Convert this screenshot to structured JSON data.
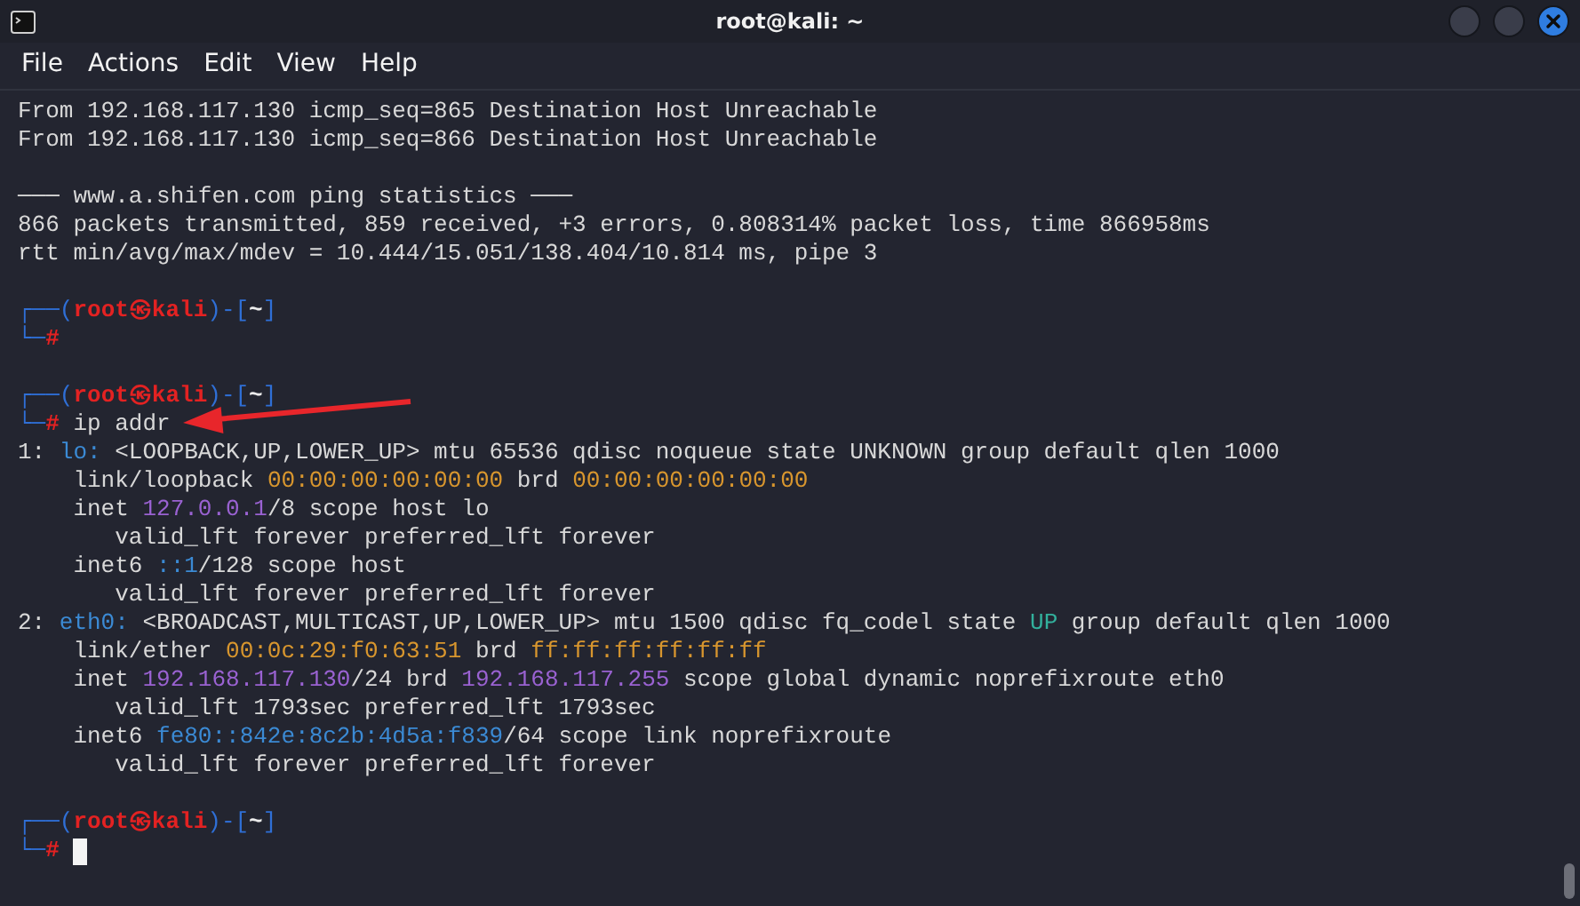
{
  "window": {
    "title": "root@kali: ~"
  },
  "menu": [
    "File",
    "Actions",
    "Edit",
    "View",
    "Help"
  ],
  "lines": [
    {
      "kind": "text",
      "segments": [
        {
          "text": "From 192.168.117.130 icmp_seq=865 Destination Host Unreachable",
          "color": "#d8d8d8"
        }
      ]
    },
    {
      "kind": "text",
      "segments": [
        {
          "text": "From 192.168.117.130 icmp_seq=866 Destination Host Unreachable",
          "color": "#d8d8d8"
        }
      ]
    },
    {
      "kind": "blank"
    },
    {
      "kind": "text",
      "segments": [
        {
          "text": "─── www.a.shifen.com ping statistics ───",
          "color": "#d8d8d8"
        }
      ]
    },
    {
      "kind": "text",
      "segments": [
        {
          "text": "866 packets transmitted, 859 received, +3 errors, 0.808314% packet loss, time 866958ms",
          "color": "#d8d8d8"
        }
      ]
    },
    {
      "kind": "text",
      "segments": [
        {
          "text": "rtt min/avg/max/mdev = 10.444/15.051/138.404/10.814 ms, pipe 3",
          "color": "#d8d8d8"
        }
      ]
    },
    {
      "kind": "blank"
    },
    {
      "kind": "text",
      "segments": [
        {
          "text": "┌──(",
          "color": "#2f6fd6"
        },
        {
          "text": "root㉿kali",
          "color": "#e32222",
          "bold": true
        },
        {
          "text": ")-[",
          "color": "#2f6fd6"
        },
        {
          "text": "~",
          "color": "#ececec",
          "bold": true
        },
        {
          "text": "]",
          "color": "#2f6fd6"
        }
      ]
    },
    {
      "kind": "text",
      "segments": [
        {
          "text": "└─",
          "color": "#2f6fd6"
        },
        {
          "text": "#",
          "color": "#e32222",
          "bold": true
        }
      ]
    },
    {
      "kind": "blank"
    },
    {
      "kind": "text",
      "segments": [
        {
          "text": "┌──(",
          "color": "#2f6fd6"
        },
        {
          "text": "root㉿kali",
          "color": "#e32222",
          "bold": true
        },
        {
          "text": ")-[",
          "color": "#2f6fd6"
        },
        {
          "text": "~",
          "color": "#ececec",
          "bold": true
        },
        {
          "text": "]",
          "color": "#2f6fd6"
        }
      ]
    },
    {
      "kind": "text",
      "segments": [
        {
          "text": "└─",
          "color": "#2f6fd6"
        },
        {
          "text": "#",
          "color": "#e32222",
          "bold": true
        },
        {
          "text": " ip addr",
          "color": "#d8d8d8"
        }
      ]
    },
    {
      "kind": "text",
      "segments": [
        {
          "text": "1: ",
          "color": "#d8d8d8"
        },
        {
          "text": "lo:",
          "color": "#3b8ad4"
        },
        {
          "text": " <LOOPBACK,UP,LOWER_UP> mtu 65536 qdisc noqueue state UNKNOWN group default qlen 1000",
          "color": "#d8d8d8"
        }
      ]
    },
    {
      "kind": "text",
      "segments": [
        {
          "text": "    link/loopback ",
          "color": "#d8d8d8"
        },
        {
          "text": "00:00:00:00:00:00",
          "color": "#d8962e"
        },
        {
          "text": " brd ",
          "color": "#d8d8d8"
        },
        {
          "text": "00:00:00:00:00:00",
          "color": "#d8962e"
        }
      ]
    },
    {
      "kind": "text",
      "segments": [
        {
          "text": "    inet ",
          "color": "#d8d8d8"
        },
        {
          "text": "127.0.0.1",
          "color": "#9a62d2"
        },
        {
          "text": "/8 scope host lo",
          "color": "#d8d8d8"
        }
      ]
    },
    {
      "kind": "text",
      "segments": [
        {
          "text": "       valid_lft forever preferred_lft forever",
          "color": "#d8d8d8"
        }
      ]
    },
    {
      "kind": "text",
      "segments": [
        {
          "text": "    inet6 ",
          "color": "#d8d8d8"
        },
        {
          "text": "::1",
          "color": "#3b8ad4"
        },
        {
          "text": "/128 scope host",
          "color": "#d8d8d8"
        }
      ]
    },
    {
      "kind": "text",
      "segments": [
        {
          "text": "       valid_lft forever preferred_lft forever",
          "color": "#d8d8d8"
        }
      ]
    },
    {
      "kind": "text",
      "segments": [
        {
          "text": "2: ",
          "color": "#d8d8d8"
        },
        {
          "text": "eth0:",
          "color": "#3b8ad4"
        },
        {
          "text": " <BROADCAST,MULTICAST,UP,LOWER_UP> mtu 1500 qdisc fq_codel state ",
          "color": "#d8d8d8"
        },
        {
          "text": "UP",
          "color": "#32b09c"
        },
        {
          "text": " group default qlen 1000",
          "color": "#d8d8d8"
        }
      ]
    },
    {
      "kind": "text",
      "segments": [
        {
          "text": "    link/ether ",
          "color": "#d8d8d8"
        },
        {
          "text": "00:0c:29:f0:63:51",
          "color": "#d8962e"
        },
        {
          "text": " brd ",
          "color": "#d8d8d8"
        },
        {
          "text": "ff:ff:ff:ff:ff:ff",
          "color": "#d8962e"
        }
      ]
    },
    {
      "kind": "text",
      "segments": [
        {
          "text": "    inet ",
          "color": "#d8d8d8"
        },
        {
          "text": "192.168.117.130",
          "color": "#9a62d2"
        },
        {
          "text": "/24 brd ",
          "color": "#d8d8d8"
        },
        {
          "text": "192.168.117.255",
          "color": "#9a62d2"
        },
        {
          "text": " scope global dynamic noprefixroute eth0",
          "color": "#d8d8d8"
        }
      ]
    },
    {
      "kind": "text",
      "segments": [
        {
          "text": "       valid_lft 1793sec preferred_lft 1793sec",
          "color": "#d8d8d8"
        }
      ]
    },
    {
      "kind": "text",
      "segments": [
        {
          "text": "    inet6 ",
          "color": "#d8d8d8"
        },
        {
          "text": "fe80::842e:8c2b:4d5a:f839",
          "color": "#3b8ad4"
        },
        {
          "text": "/64 scope link noprefixroute",
          "color": "#d8d8d8"
        }
      ]
    },
    {
      "kind": "text",
      "segments": [
        {
          "text": "       valid_lft forever preferred_lft forever",
          "color": "#d8d8d8"
        }
      ]
    },
    {
      "kind": "blank"
    },
    {
      "kind": "text",
      "segments": [
        {
          "text": "┌──(",
          "color": "#2f6fd6"
        },
        {
          "text": "root㉿kali",
          "color": "#e32222",
          "bold": true
        },
        {
          "text": ")-[",
          "color": "#2f6fd6"
        },
        {
          "text": "~",
          "color": "#ececec",
          "bold": true
        },
        {
          "text": "]",
          "color": "#2f6fd6"
        }
      ]
    },
    {
      "kind": "text",
      "cursor": true,
      "segments": [
        {
          "text": "└─",
          "color": "#2f6fd6"
        },
        {
          "text": "#",
          "color": "#e32222",
          "bold": true
        }
      ]
    }
  ]
}
